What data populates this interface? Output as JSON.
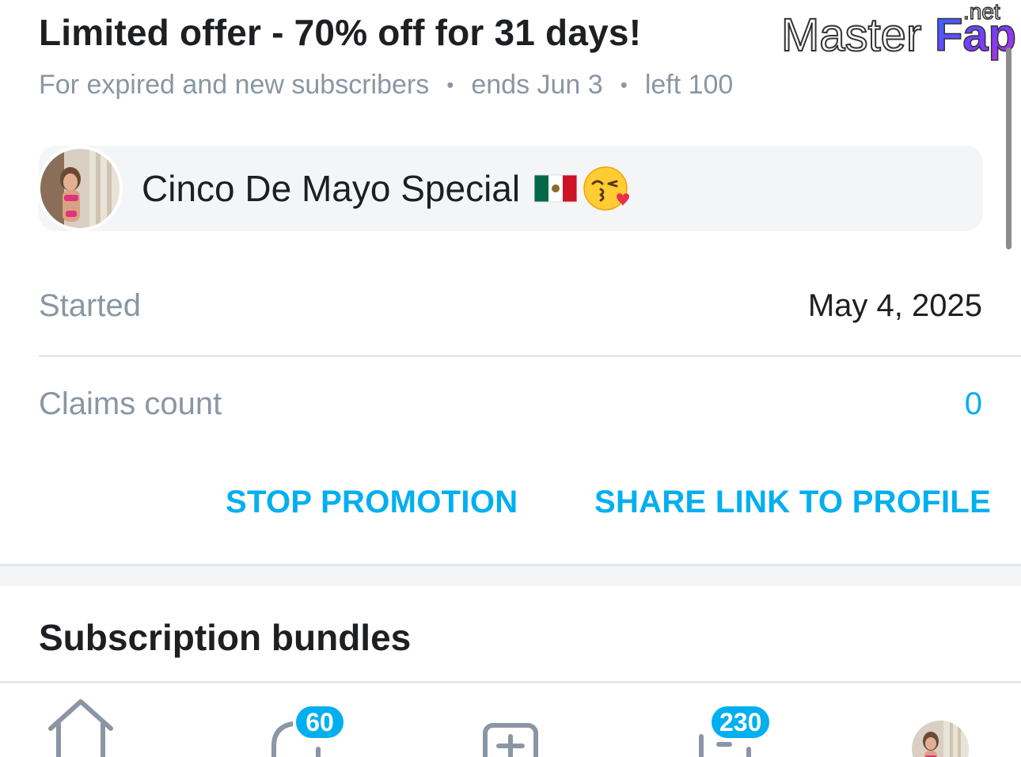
{
  "promo": {
    "title": "Limited offer - 70% off for 31 days!",
    "audience": "For expired and new subscribers",
    "separator": "•",
    "ends": "ends Jun 3",
    "left": "left 100",
    "message": "Cinco De Mayo Special"
  },
  "details": {
    "started_label": "Started",
    "started_value": "May 4, 2025",
    "claims_label": "Claims count",
    "claims_value": "0"
  },
  "actions": {
    "stop_label": "STOP PROMOTION",
    "share_label": "SHARE LINK TO PROFILE"
  },
  "section": {
    "title": "Subscription bundles"
  },
  "watermark": {
    "text": "MasterFap",
    "suffix": ".net"
  },
  "nav": {
    "items": [
      {
        "icon": "home-icon"
      },
      {
        "icon": "messages-icon",
        "badge": "60"
      },
      {
        "icon": "add-post-icon"
      },
      {
        "icon": "notifications-icon",
        "badge": "230"
      },
      {
        "icon": "profile-avatar"
      }
    ]
  },
  "colors": {
    "accent": "#00aff0",
    "muted_text": "#8a96a3",
    "primary_text": "#1d1f22",
    "pill_bg": "#f3f5f7"
  }
}
